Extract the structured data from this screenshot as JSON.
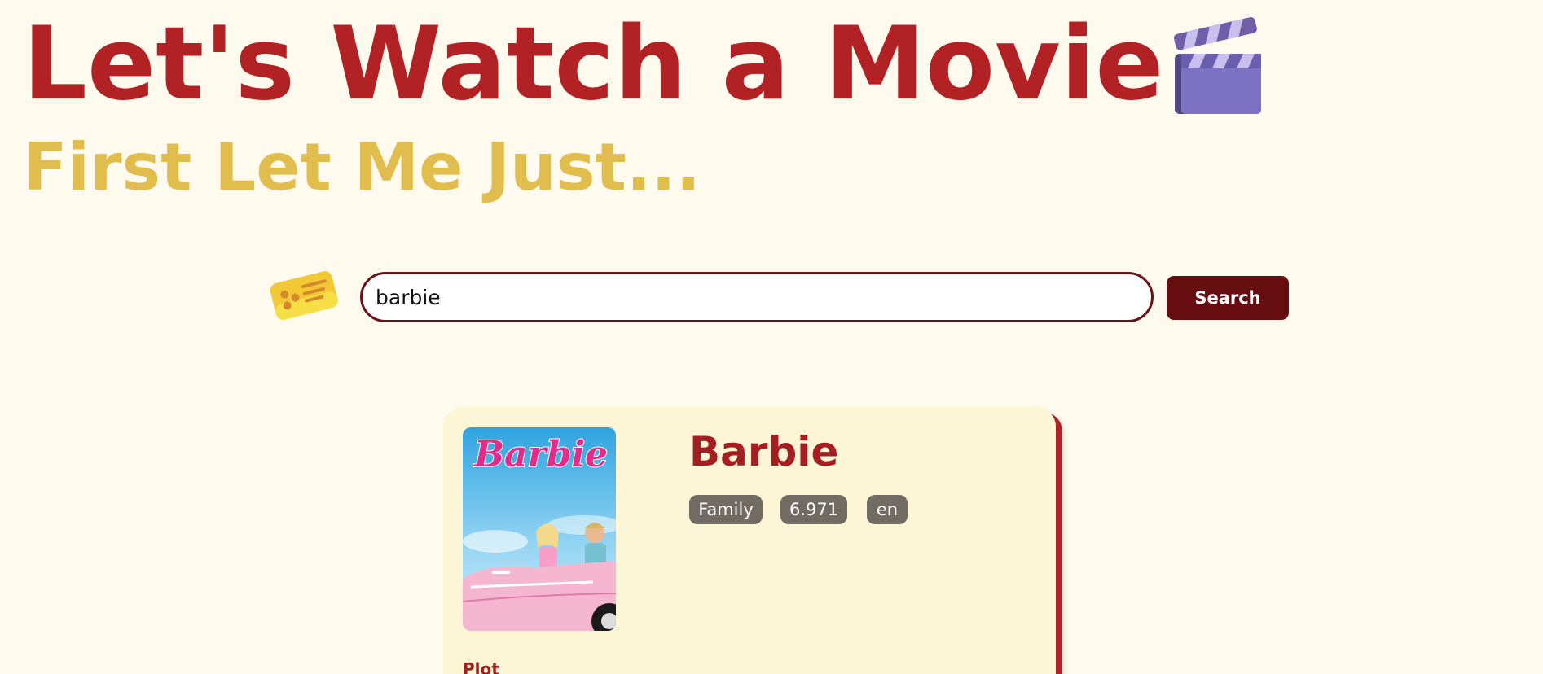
{
  "header": {
    "title": "Let's Watch a Movie",
    "subtitle": "First Let Me Just..."
  },
  "search": {
    "value": "barbie",
    "button_label": "Search"
  },
  "result": {
    "poster_logo_text": "Barbie",
    "title": "Barbie",
    "genre": "Family",
    "rating": "6.971",
    "language": "en",
    "plot_label": "Plot"
  },
  "icons": {
    "header": "clapperboard-icon",
    "search": "ticket-icon"
  },
  "colors": {
    "background": "#fffaee",
    "title": "#b22124",
    "subtitle": "#e1bd4e",
    "button": "#660d0f",
    "card": "#fcf5d6",
    "tag": "#726b63"
  }
}
